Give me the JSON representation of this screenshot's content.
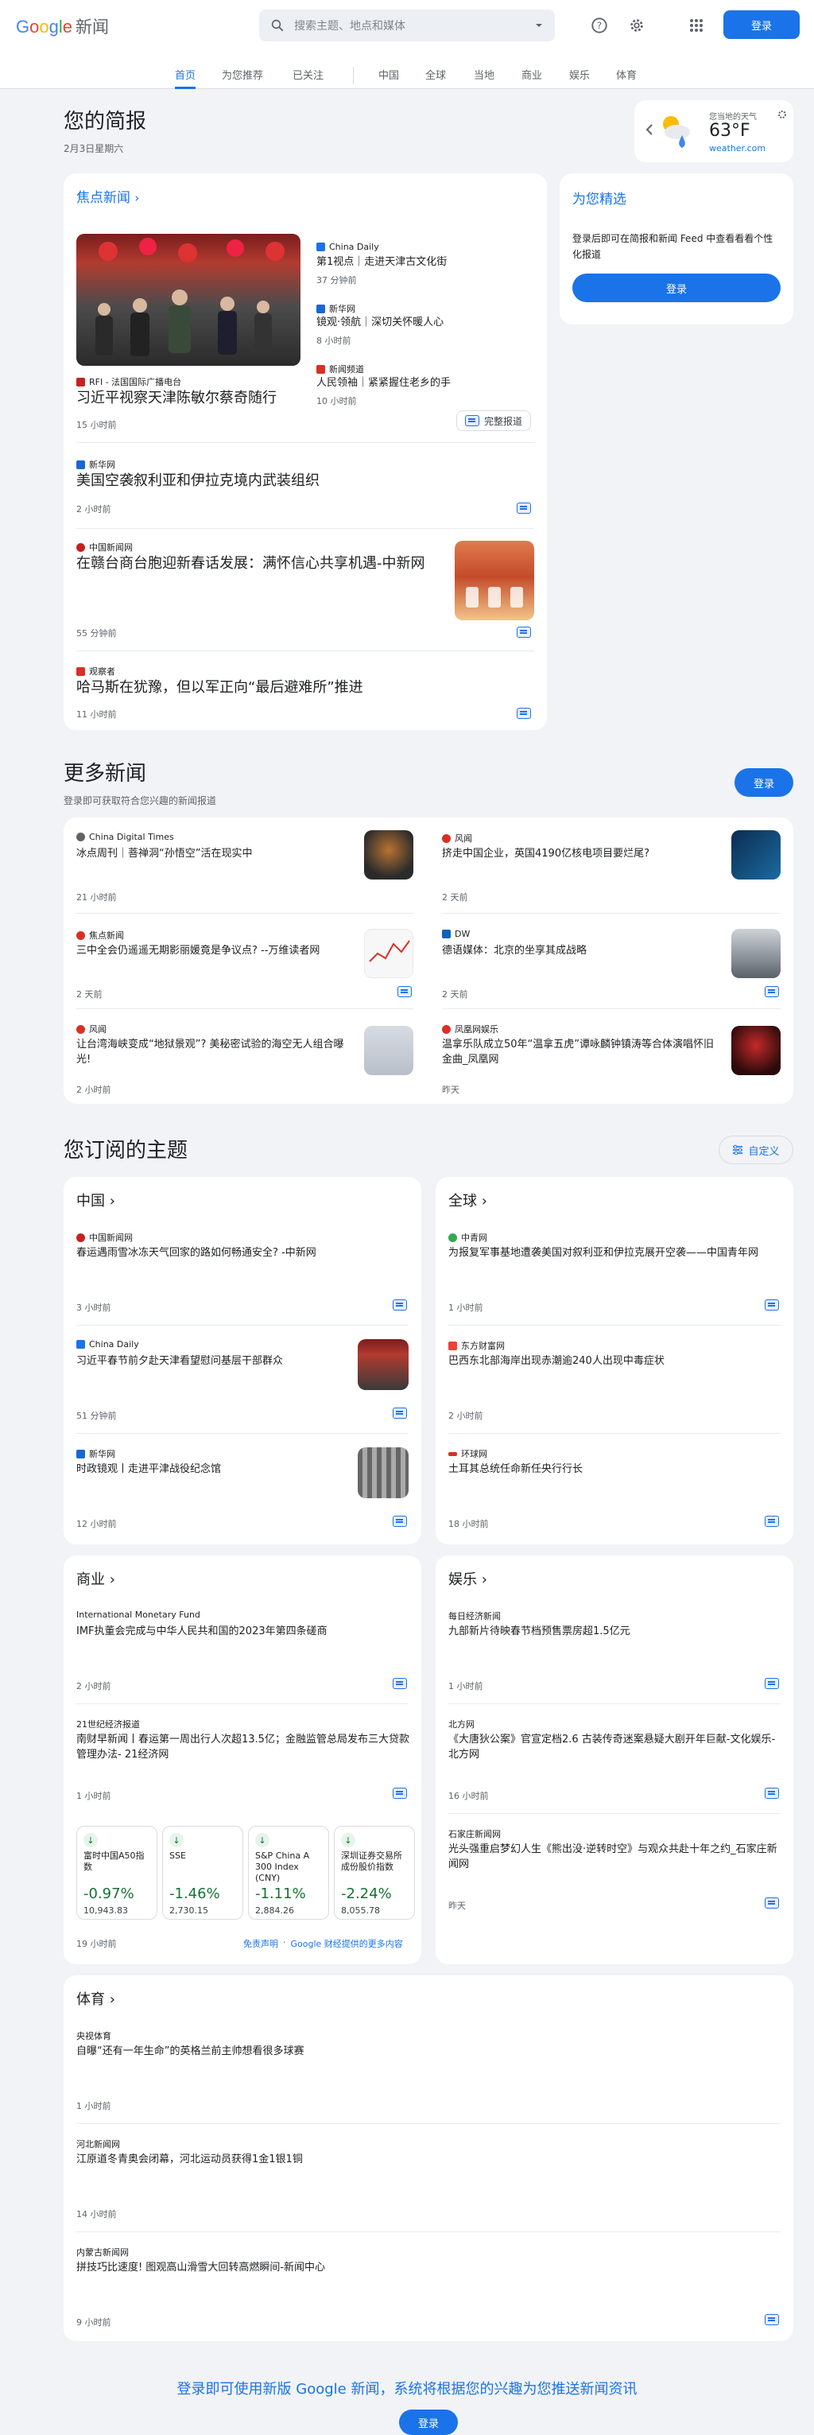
{
  "header": {
    "logo_google": "Google",
    "logo_news": "新闻",
    "search_placeholder": "搜索主题、地点和媒体",
    "signin": "登录"
  },
  "tabs": [
    "首页",
    "为您推荐",
    "已关注",
    "中国",
    "全球",
    "当地",
    "商业",
    "娱乐",
    "体育"
  ],
  "briefing": {
    "title": "您的简报",
    "date": "2月3日星期六"
  },
  "weather": {
    "label": "您当地的天气",
    "temp": "63°F",
    "source": "weather.com"
  },
  "top_stories": {
    "title": "焦点新闻",
    "lead": {
      "source": "RFI - 法国国际广播电台",
      "title": "习近平视察天津陈敏尔蔡奇随行",
      "time": "15 小时前",
      "full_coverage": "完整报道"
    },
    "side": [
      {
        "source": "China Daily",
        "title": "第1视点｜走进天津古文化街",
        "time": "37 分钟前"
      },
      {
        "source": "新华网",
        "title": "镜观·领航｜深切关怀暖人心",
        "time": "8 小时前"
      },
      {
        "source": "新闻频道",
        "title": "人民领袖｜紧紧握住老乡的手",
        "time": "10 小时前"
      }
    ],
    "items": [
      {
        "source": "新华网",
        "title": "美国空袭叙利亚和伊拉克境内武装组织",
        "time": "2 小时前"
      },
      {
        "source": "中国新闻网",
        "title": "在赣台商台胞迎新春话发展：满怀信心共享机遇-中新网",
        "time": "55 分钟前"
      },
      {
        "source": "观察者",
        "title": "哈马斯在犹豫，但以军正向“最后避难所”推进",
        "time": "11 小时前"
      }
    ]
  },
  "picks": {
    "title": "为您精选",
    "text": "登录后即可在简报和新闻 Feed 中查看看看个性化报道",
    "signin": "登录"
  },
  "more_news": {
    "title": "更多新闻",
    "subtitle": "登录即可获取符合您兴趣的新闻报道",
    "signin": "登录",
    "items": [
      {
        "source": "China Digital Times",
        "title": "冰点周刊｜菩禅洞“孙悟空”活在现实中",
        "time": "21 小时前"
      },
      {
        "source": "风闻",
        "title": "挤走中国企业，英国4190亿核电项目要烂尾?",
        "time": "2 天前"
      },
      {
        "source": "焦点新闻",
        "title": "三中全会仍遥遥无期影丽媛竟是争议点? --万维读者网",
        "time": "2 天前"
      },
      {
        "source": "DW",
        "title": "德语媒体：北京的坐享其成战略",
        "time": "2 天前"
      },
      {
        "source": "风闻",
        "title": "让台湾海峡变成“地狱景观”? 美秘密试验的海空无人组合曝光!",
        "time": "2 小时前"
      },
      {
        "source": "凤凰网娱乐",
        "title": "温拿乐队成立50年“温拿五虎”谭咏麟钟镇涛等合体演唱怀旧金曲_凤凰网",
        "time": "昨天"
      }
    ]
  },
  "topics": {
    "title": "您订阅的主题",
    "customize": "自定义",
    "china": {
      "title": "中国",
      "items": [
        {
          "source": "中国新闻网",
          "title": "春运遇雨雪冰冻天气回家的路如何畅通安全? -中新网",
          "time": "3 小时前"
        },
        {
          "source": "China Daily",
          "title": "习近平春节前夕赴天津看望慰问基层干部群众",
          "time": "51 分钟前"
        },
        {
          "source": "新华网",
          "title": "时政镜观丨走进平津战役纪念馆",
          "time": "12 小时前"
        }
      ]
    },
    "world": {
      "title": "全球",
      "items": [
        {
          "source": "中青网",
          "title": "为报复军事基地遭袭美国对叙利亚和伊拉克展开空袭——中国青年网",
          "time": "1 小时前"
        },
        {
          "source": "东方财富网",
          "title": "巴西东北部海岸出现赤潮逾240人出现中毒症状",
          "time": "2 小时前"
        },
        {
          "source": "环球网",
          "title": "土耳其总统任命新任央行行长",
          "time": "18 小时前"
        }
      ]
    },
    "business": {
      "title": "商业",
      "items": [
        {
          "source": "International Monetary Fund",
          "title": "IMF执董会完成与中华人民共和国的2023年第四条磋商",
          "time": "2 小时前"
        },
        {
          "source": "21世纪经济报道",
          "title": "南财早新闻丨春运第一周出行人次超13.5亿；金融监管总局发布三大贷款管理办法- 21经济网",
          "time": "1 小时前"
        }
      ],
      "stocks": [
        {
          "name": "富时中国A50指数",
          "pct": "-0.97%",
          "value": "10,943.83"
        },
        {
          "name": "SSE",
          "pct": "-1.46%",
          "value": "2,730.15"
        },
        {
          "name": "S&P China A 300 Index (CNY)",
          "pct": "-1.11%",
          "value": "2,884.26"
        },
        {
          "name": "深圳证券交易所成份股价指数",
          "pct": "-2.24%",
          "value": "8,055.78"
        }
      ],
      "stock_time": "19 小时前",
      "disclaimer": "免责声明",
      "more": "Google 财经提供的更多内容"
    },
    "entertainment": {
      "title": "娱乐",
      "items": [
        {
          "source": "每日经济新闻",
          "title": "九部新片待映春节档预售票房超1.5亿元",
          "time": "1 小时前"
        },
        {
          "source": "北方网",
          "title": "《大唐狄公案》官宣定档2.6 古装传奇迷案悬疑大剧开年巨献-文化娱乐-北方网",
          "time": "16 小时前"
        },
        {
          "source": "石家庄新闻网",
          "title": "光头强重启梦幻人生《熊出没·逆转时空》与观众共赴十年之约_石家庄新闻网",
          "time": "昨天"
        }
      ]
    },
    "sports": {
      "title": "体育",
      "items": [
        {
          "source": "央视体育",
          "title": "自曝“还有一年生命”的英格兰前主帅想看很多球赛",
          "time": "1 小时前"
        },
        {
          "source": "河北新闻网",
          "title": "江原道冬青奥会闭幕，河北运动员获得1金1银1铜",
          "time": "14 小时前"
        },
        {
          "source": "内蒙古新闻网",
          "title": "拼技巧比速度! 图观高山滑雪大回转高燃瞬间-新闻中心",
          "time": "9 小时前"
        }
      ]
    }
  },
  "footer": {
    "text": "登录即可使用新版 Google 新闻，系统将根据您的兴趣为您推送新闻资讯",
    "signin": "登录"
  }
}
